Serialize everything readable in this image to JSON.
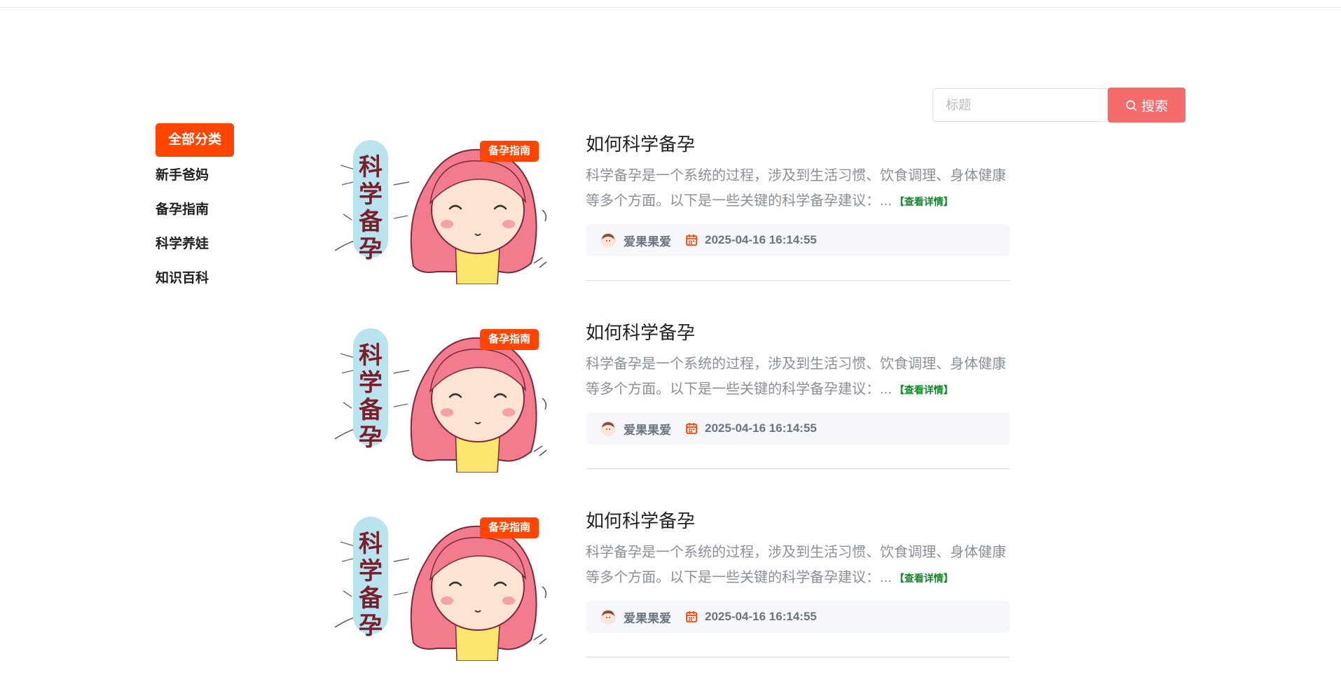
{
  "search": {
    "placeholder": "标题",
    "button_label": "搜索"
  },
  "sidebar": {
    "active_label": "全部分类",
    "items": [
      {
        "label": "新手爸妈"
      },
      {
        "label": "备孕指南"
      },
      {
        "label": "科学养娃"
      },
      {
        "label": "知识百科"
      }
    ]
  },
  "thumb_text": "科学备孕",
  "articles": [
    {
      "badge": "备孕指南",
      "title": "如何科学备孕",
      "desc": "科学备孕是一个系统的过程，涉及到生活习惯、饮食调理、身体健康等多个方面。以下是一些关键的科学备孕建议：...",
      "more": "【查看详情】",
      "author": "爱果果爱",
      "date": "2025-04-16 16:14:55"
    },
    {
      "badge": "备孕指南",
      "title": "如何科学备孕",
      "desc": "科学备孕是一个系统的过程，涉及到生活习惯、饮食调理、身体健康等多个方面。以下是一些关键的科学备孕建议：...",
      "more": "【查看详情】",
      "author": "爱果果爱",
      "date": "2025-04-16 16:14:55"
    },
    {
      "badge": "备孕指南",
      "title": "如何科学备孕",
      "desc": "科学备孕是一个系统的过程，涉及到生活习惯、饮食调理、身体健康等多个方面。以下是一些关键的科学备孕建议：...",
      "more": "【查看详情】",
      "author": "爱果果爱",
      "date": "2025-04-16 16:14:55"
    }
  ],
  "colors": {
    "accent": "#ff4500",
    "search_button": "#f56c6c",
    "link": "#0d8a24"
  }
}
